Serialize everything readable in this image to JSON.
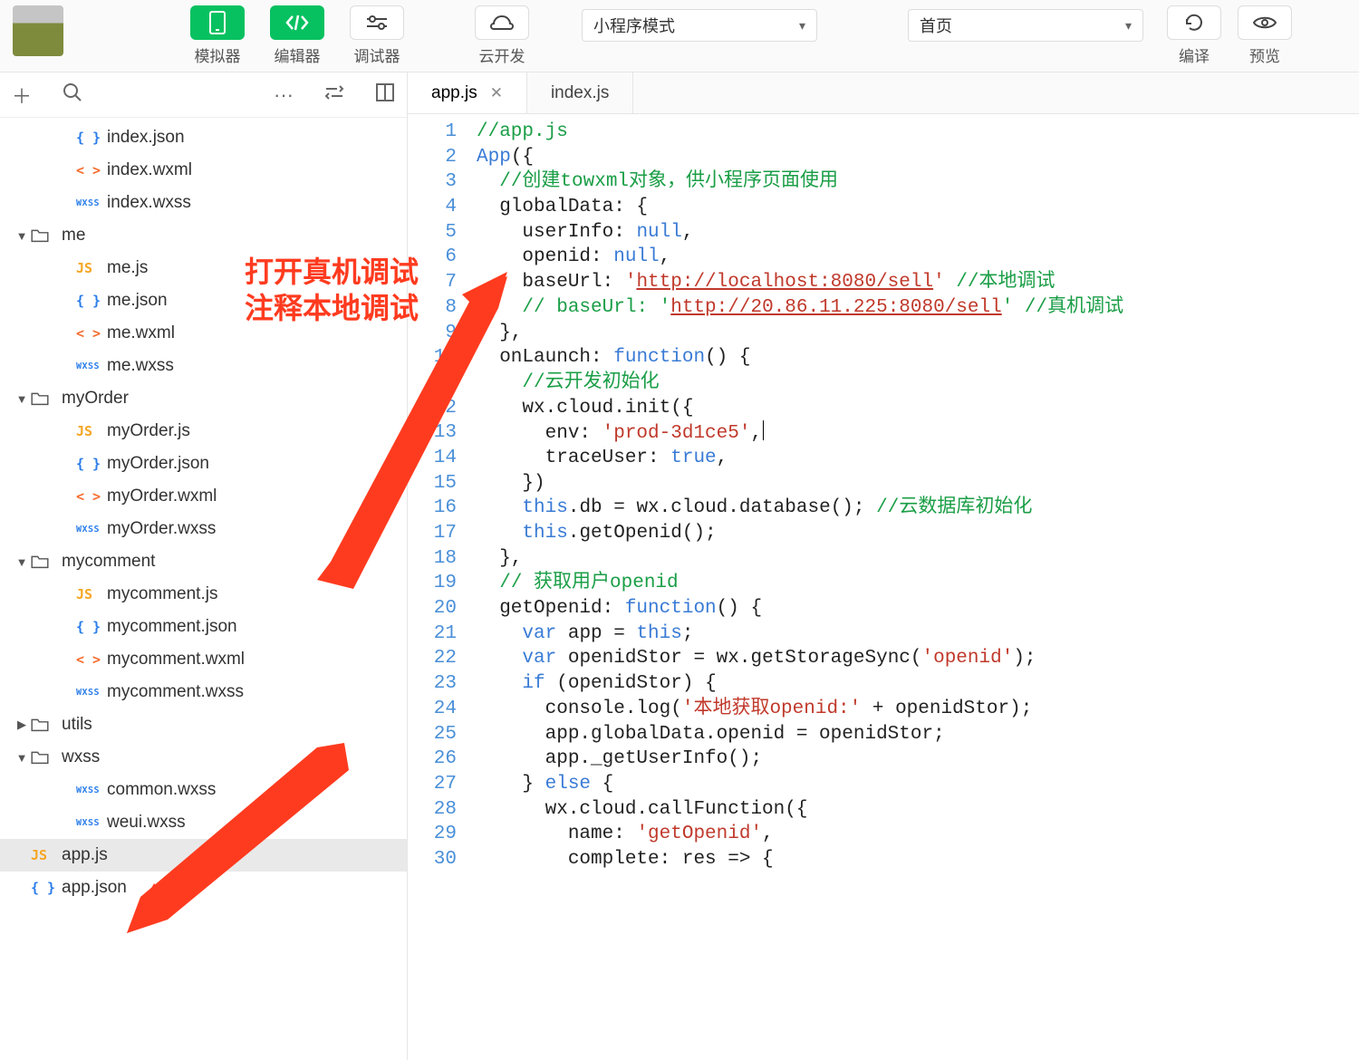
{
  "toolbar": {
    "simulator": "模拟器",
    "editor": "编辑器",
    "debugger": "调试器",
    "cloud": "云开发",
    "mode_dropdown": "小程序模式",
    "page_dropdown": "首页",
    "compile": "编译",
    "preview": "预览"
  },
  "explorer_actions": {
    "add": "＋",
    "search": "⌕",
    "more": "···",
    "collapse": "⇆",
    "split": "◫"
  },
  "tree": [
    {
      "type": "file",
      "icon": "json",
      "depth": 1,
      "name": "index.json"
    },
    {
      "type": "file",
      "icon": "wxml",
      "depth": 1,
      "name": "index.wxml"
    },
    {
      "type": "file",
      "icon": "wxss",
      "depth": 1,
      "name": "index.wxss"
    },
    {
      "type": "folder",
      "open": true,
      "depth": 0,
      "name": "me"
    },
    {
      "type": "file",
      "icon": "js",
      "depth": 1,
      "name": "me.js"
    },
    {
      "type": "file",
      "icon": "json",
      "depth": 1,
      "name": "me.json"
    },
    {
      "type": "file",
      "icon": "wxml",
      "depth": 1,
      "name": "me.wxml"
    },
    {
      "type": "file",
      "icon": "wxss",
      "depth": 1,
      "name": "me.wxss"
    },
    {
      "type": "folder",
      "open": true,
      "depth": 0,
      "name": "myOrder"
    },
    {
      "type": "file",
      "icon": "js",
      "depth": 1,
      "name": "myOrder.js"
    },
    {
      "type": "file",
      "icon": "json",
      "depth": 1,
      "name": "myOrder.json"
    },
    {
      "type": "file",
      "icon": "wxml",
      "depth": 1,
      "name": "myOrder.wxml"
    },
    {
      "type": "file",
      "icon": "wxss",
      "depth": 1,
      "name": "myOrder.wxss"
    },
    {
      "type": "folder",
      "open": true,
      "depth": 0,
      "name": "mycomment"
    },
    {
      "type": "file",
      "icon": "js",
      "depth": 1,
      "name": "mycomment.js"
    },
    {
      "type": "file",
      "icon": "json",
      "depth": 1,
      "name": "mycomment.json"
    },
    {
      "type": "file",
      "icon": "wxml",
      "depth": 1,
      "name": "mycomment.wxml"
    },
    {
      "type": "file",
      "icon": "wxss",
      "depth": 1,
      "name": "mycomment.wxss"
    },
    {
      "type": "folder",
      "open": false,
      "depth": 0,
      "name": "utils"
    },
    {
      "type": "folder",
      "open": true,
      "depth": 0,
      "name": "wxss"
    },
    {
      "type": "file",
      "icon": "wxss",
      "depth": 1,
      "name": "common.wxss"
    },
    {
      "type": "file",
      "icon": "wxss",
      "depth": 1,
      "name": "weui.wxss"
    },
    {
      "type": "file",
      "icon": "js",
      "depth": 0,
      "name": "app.js",
      "selected": true
    },
    {
      "type": "file",
      "icon": "json",
      "depth": 0,
      "name": "app.json"
    }
  ],
  "annotation": {
    "line1": "打开真机调试",
    "line2": "注释本地调试"
  },
  "tabs": [
    {
      "label": "app.js",
      "active": true
    },
    {
      "label": "index.js",
      "active": false
    }
  ],
  "code_lines": [
    [
      {
        "t": "//app.js",
        "c": "c-comment"
      }
    ],
    [
      {
        "t": "App",
        "c": "c-fn"
      },
      {
        "t": "({"
      }
    ],
    [
      {
        "t": "  "
      },
      {
        "t": "//创建towxml对象，供小程序页面使用",
        "c": "c-comment"
      }
    ],
    [
      {
        "t": "  globalData: {"
      }
    ],
    [
      {
        "t": "    userInfo: "
      },
      {
        "t": "null",
        "c": "c-kw"
      },
      {
        "t": ","
      }
    ],
    [
      {
        "t": "    openid: "
      },
      {
        "t": "null",
        "c": "c-kw"
      },
      {
        "t": ","
      }
    ],
    [
      {
        "t": "    baseUrl: "
      },
      {
        "t": "'",
        "c": "c-str"
      },
      {
        "t": "http://localhost:8080/sell",
        "c": "c-url"
      },
      {
        "t": "'",
        "c": "c-str"
      },
      {
        "t": " "
      },
      {
        "t": "//本地调试",
        "c": "c-comment"
      }
    ],
    [
      {
        "t": "    "
      },
      {
        "t": "// baseUrl: '",
        "c": "c-comment"
      },
      {
        "t": "http://20.86.11.225:8080/sell",
        "c": "c-url"
      },
      {
        "t": "' //真机调试",
        "c": "c-comment"
      }
    ],
    [
      {
        "t": "  },"
      }
    ],
    [
      {
        "t": "  onLaunch: "
      },
      {
        "t": "function",
        "c": "c-kw"
      },
      {
        "t": "() {"
      }
    ],
    [
      {
        "t": "    "
      },
      {
        "t": "//云开发初始化",
        "c": "c-comment"
      }
    ],
    [
      {
        "t": "    wx.cloud.init({"
      }
    ],
    [
      {
        "t": "      env: "
      },
      {
        "t": "'prod-3d1ce5'",
        "c": "c-str"
      },
      {
        "t": ",",
        "cursor": true
      }
    ],
    [
      {
        "t": "      traceUser: "
      },
      {
        "t": "true",
        "c": "c-kw"
      },
      {
        "t": ","
      }
    ],
    [
      {
        "t": "    })"
      }
    ],
    [
      {
        "t": "    "
      },
      {
        "t": "this",
        "c": "c-kw"
      },
      {
        "t": ".db = wx.cloud.database(); "
      },
      {
        "t": "//云数据库初始化",
        "c": "c-comment"
      }
    ],
    [
      {
        "t": "    "
      },
      {
        "t": "this",
        "c": "c-kw"
      },
      {
        "t": ".getOpenid();"
      }
    ],
    [
      {
        "t": "  },"
      }
    ],
    [
      {
        "t": "  "
      },
      {
        "t": "// 获取用户openid",
        "c": "c-comment"
      }
    ],
    [
      {
        "t": "  getOpenid: "
      },
      {
        "t": "function",
        "c": "c-kw"
      },
      {
        "t": "() {"
      }
    ],
    [
      {
        "t": "    "
      },
      {
        "t": "var",
        "c": "c-kw"
      },
      {
        "t": " app = "
      },
      {
        "t": "this",
        "c": "c-kw"
      },
      {
        "t": ";"
      }
    ],
    [
      {
        "t": "    "
      },
      {
        "t": "var",
        "c": "c-kw"
      },
      {
        "t": " openidStor = wx.getStorageSync("
      },
      {
        "t": "'openid'",
        "c": "c-str"
      },
      {
        "t": ");"
      }
    ],
    [
      {
        "t": "    "
      },
      {
        "t": "if",
        "c": "c-kw"
      },
      {
        "t": " (openidStor) {"
      }
    ],
    [
      {
        "t": "      console.log("
      },
      {
        "t": "'本地获取openid:'",
        "c": "c-str"
      },
      {
        "t": " + openidStor);"
      }
    ],
    [
      {
        "t": "      app.globalData.openid = openidStor;"
      }
    ],
    [
      {
        "t": "      app._getUserInfo();"
      }
    ],
    [
      {
        "t": "    } "
      },
      {
        "t": "else",
        "c": "c-kw"
      },
      {
        "t": " {"
      }
    ],
    [
      {
        "t": "      wx.cloud.callFunction({"
      }
    ],
    [
      {
        "t": "        name: "
      },
      {
        "t": "'getOpenid'",
        "c": "c-str"
      },
      {
        "t": ","
      }
    ],
    [
      {
        "t": "        complete: res => {"
      }
    ]
  ]
}
